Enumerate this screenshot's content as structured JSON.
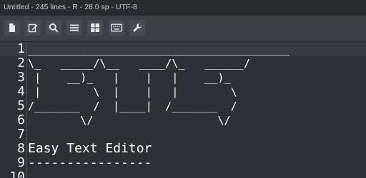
{
  "status_bar": {
    "text": "Untitled - 245 lines - R - 28.0 sp - UTF-8"
  },
  "toolbar": {
    "buttons": [
      {
        "icon": "new-file-icon"
      },
      {
        "icon": "edit-icon"
      },
      {
        "icon": "search-icon"
      },
      {
        "icon": "menu-icon"
      },
      {
        "icon": "grid-icon"
      },
      {
        "icon": "keyboard-icon"
      },
      {
        "icon": "wrench-icon"
      }
    ]
  },
  "editor": {
    "lines": [
      {
        "num": "1",
        "text": "________________________________________"
      },
      {
        "num": "2",
        "text": "\\_   _____/\\__   ____/\\_   ______/"
      },
      {
        "num": "3",
        "text": " |    __)_   |    |   |    __)_"
      },
      {
        "num": "4",
        "text": " |        \\  |    |   |        \\"
      },
      {
        "num": "5",
        "text": "/_______  /  |____|  /_______  /"
      },
      {
        "num": "6",
        "text": "        \\/                   \\/"
      },
      {
        "num": "7",
        "text": ""
      },
      {
        "num": "8",
        "text": "Easy Text Editor"
      },
      {
        "num": "9",
        "text": "----------------"
      },
      {
        "num": "10",
        "text": ""
      }
    ]
  }
}
